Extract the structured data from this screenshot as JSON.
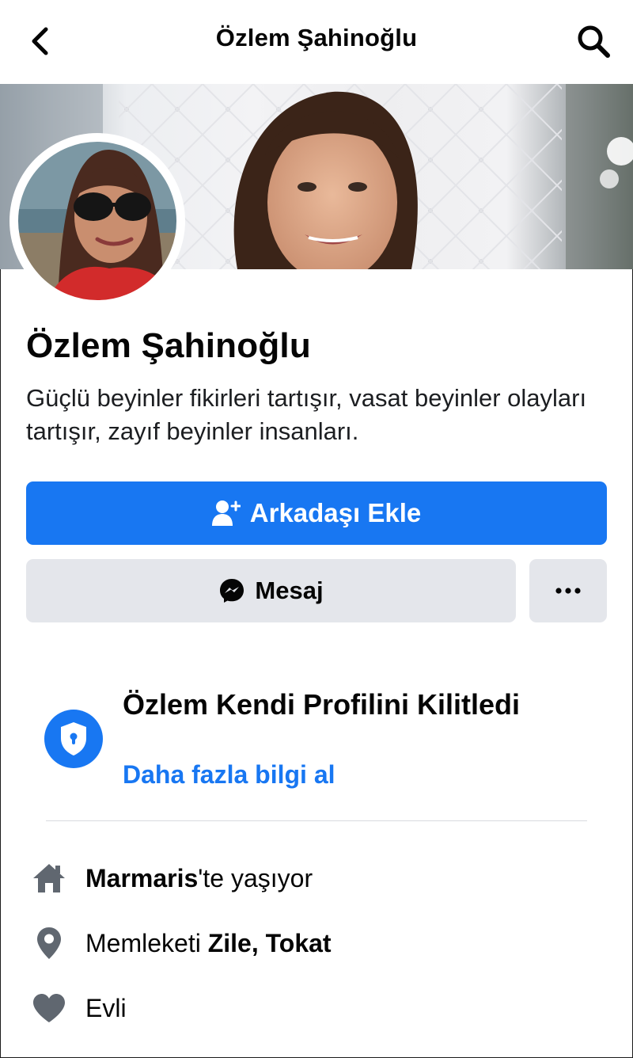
{
  "header": {
    "title": "Özlem Şahinoğlu",
    "back_icon": "chevron-left-icon",
    "search_icon": "search-icon"
  },
  "profile": {
    "name": "Özlem Şahinoğlu",
    "bio": "Güçlü beyinler fikirleri tartışır, vasat beyinler olayları tartışır, zayıf beyinler insanları."
  },
  "actions": {
    "add_friend_label": "Arkadaşı Ekle",
    "message_label": "Mesaj",
    "more_label": "···"
  },
  "locked": {
    "title": "Özlem Kendi Profilini Kilitledi",
    "link": "Daha fazla bilgi al"
  },
  "info": {
    "lives_city": "Marmaris",
    "lives_suffix": "'te yaşıyor",
    "hometown_prefix": "Memleketi ",
    "hometown": "Zile, Tokat",
    "relationship": "Evli"
  },
  "colors": {
    "accent": "#1877f2",
    "secondary_button": "#e4e6eb",
    "icon_gray": "#606770"
  }
}
